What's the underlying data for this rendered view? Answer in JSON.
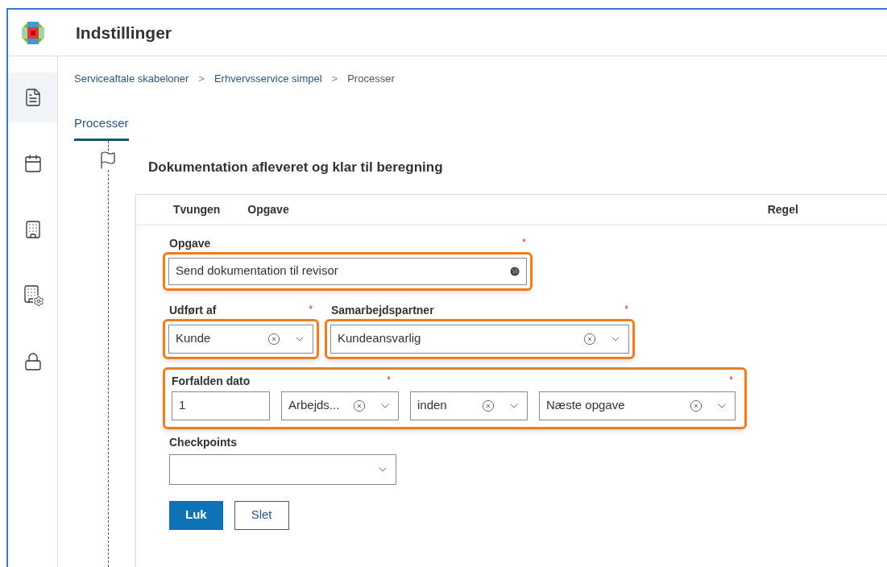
{
  "header": {
    "title": "Indstillinger"
  },
  "sidebar": {
    "items": [
      {
        "kind": "document",
        "selected": true
      },
      {
        "kind": "calendar",
        "selected": false
      },
      {
        "kind": "building",
        "selected": false
      },
      {
        "kind": "building-settings",
        "selected": false
      },
      {
        "kind": "lock",
        "selected": false
      }
    ]
  },
  "breadcrumb": [
    "Serviceaftale skabeloner",
    "Erhvervsservice simpel",
    "Processer"
  ],
  "breadcrumb_separator": ">",
  "tabs": [
    {
      "label": "Processer",
      "selected": true
    }
  ],
  "step": {
    "title": "Dokumentation afleveret og klar til beregning"
  },
  "table": {
    "columns": [
      "Tvungen",
      "Opgave",
      "Regel"
    ]
  },
  "form": {
    "task": {
      "label": "Opgave",
      "required_mark": "*",
      "value": "Send dokumentation til revisor",
      "highlighted": true
    },
    "assignees": [
      {
        "label": "Udført af",
        "required_mark": "*",
        "value": "Kunde",
        "highlighted": true
      },
      {
        "label": "Samarbejdspartner",
        "required_mark": "*",
        "value": "Kundeansvarlig",
        "highlighted": true
      }
    ],
    "due_date": {
      "label": "Forfalden dato",
      "required_marks": [
        "*",
        "*"
      ],
      "highlighted": true,
      "parts": [
        {
          "kind": "number",
          "value": "1"
        },
        {
          "kind": "select",
          "value": "Arbejds..."
        },
        {
          "kind": "select",
          "value": "inden"
        },
        {
          "kind": "select",
          "value": "Næste opgave"
        }
      ]
    },
    "checkpoints": {
      "label": "Checkpoints"
    },
    "buttons": [
      {
        "label": "Luk",
        "kind": "primary"
      },
      {
        "label": "Slet",
        "kind": "secondary"
      }
    ]
  }
}
